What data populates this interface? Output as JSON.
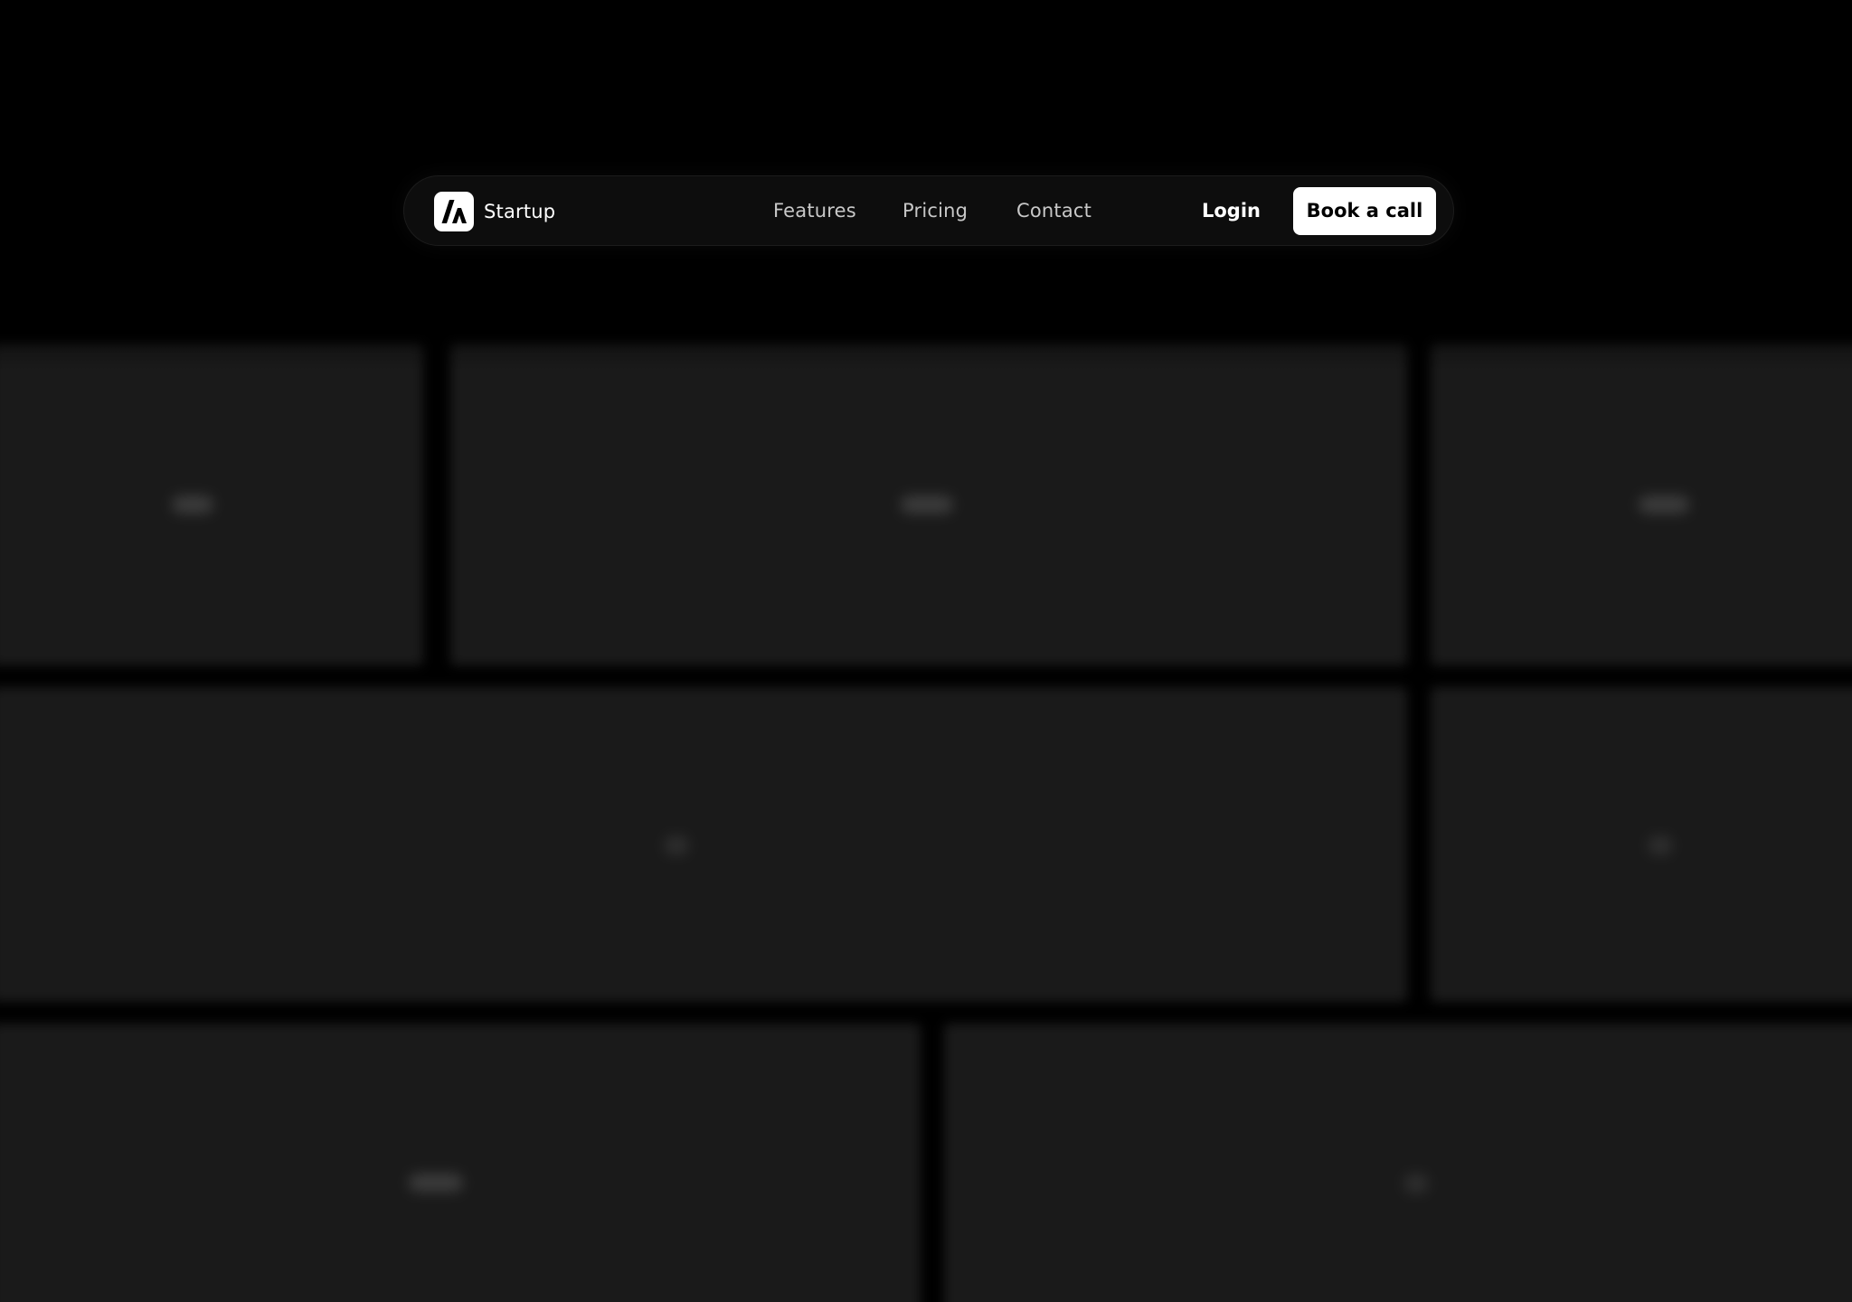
{
  "nav": {
    "brand_name": "Startup",
    "logo_icon": "startup-logo-icon",
    "links": [
      {
        "label": "Features"
      },
      {
        "label": "Pricing"
      },
      {
        "label": "Contact"
      }
    ],
    "login_label": "Login",
    "cta_label": "Book a call"
  },
  "colors": {
    "background": "#000000",
    "navbar": "#0d0d0d",
    "tile": "#1a1a1a",
    "cta_background": "#ffffff",
    "cta_text": "#000000"
  }
}
